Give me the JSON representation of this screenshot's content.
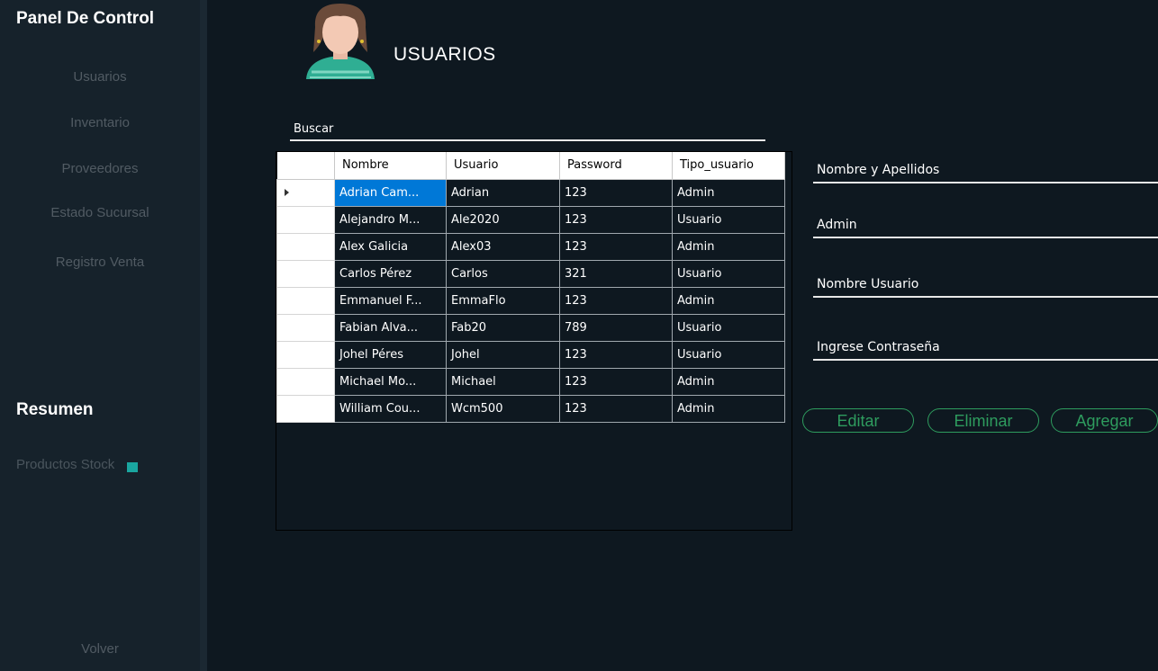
{
  "sidebar": {
    "title": "Panel De Control",
    "nav": [
      "Usuarios",
      "Inventario",
      "Proveedores",
      "Estado Sucursal",
      "Registro Venta"
    ],
    "summary_title": "Resumen",
    "products_stock": "Productos Stock",
    "back": "Volver"
  },
  "header": {
    "title": "USUARIOS"
  },
  "search": {
    "placeholder": "Buscar"
  },
  "grid": {
    "columns": [
      "Nombre",
      "Usuario",
      "Password",
      "Tipo_usuario"
    ],
    "rows": [
      [
        "Adrian Cam...",
        "Adrian",
        "123",
        "Admin"
      ],
      [
        "Alejandro M...",
        "Ale2020",
        "123",
        "Usuario"
      ],
      [
        "Alex Galicia",
        "Alex03",
        "123",
        "Admin"
      ],
      [
        "Carlos Pérez",
        "Carlos",
        "321",
        "Usuario"
      ],
      [
        "Emmanuel F...",
        "EmmaFlo",
        "123",
        "Admin"
      ],
      [
        "Fabian Alva...",
        "Fab20",
        "789",
        "Usuario"
      ],
      [
        "Johel Péres",
        "Johel",
        "123",
        "Usuario"
      ],
      [
        "Michael Mo...",
        "Michael",
        "123",
        "Admin"
      ],
      [
        "William Cou...",
        "Wcm500",
        "123",
        "Admin"
      ]
    ],
    "selected_row": 0
  },
  "form": {
    "fullname_placeholder": "Nombre y Apellidos",
    "type_placeholder": "Admin",
    "username_placeholder": "Nombre Usuario",
    "password_placeholder": "Ingrese Contraseña"
  },
  "buttons": {
    "edit": "Editar",
    "delete": "Eliminar",
    "add": "Agregar"
  },
  "colors": {
    "accent": "#2e9c5e",
    "stock_indicator": "#1aa6a0",
    "selection": "#0078d7"
  }
}
